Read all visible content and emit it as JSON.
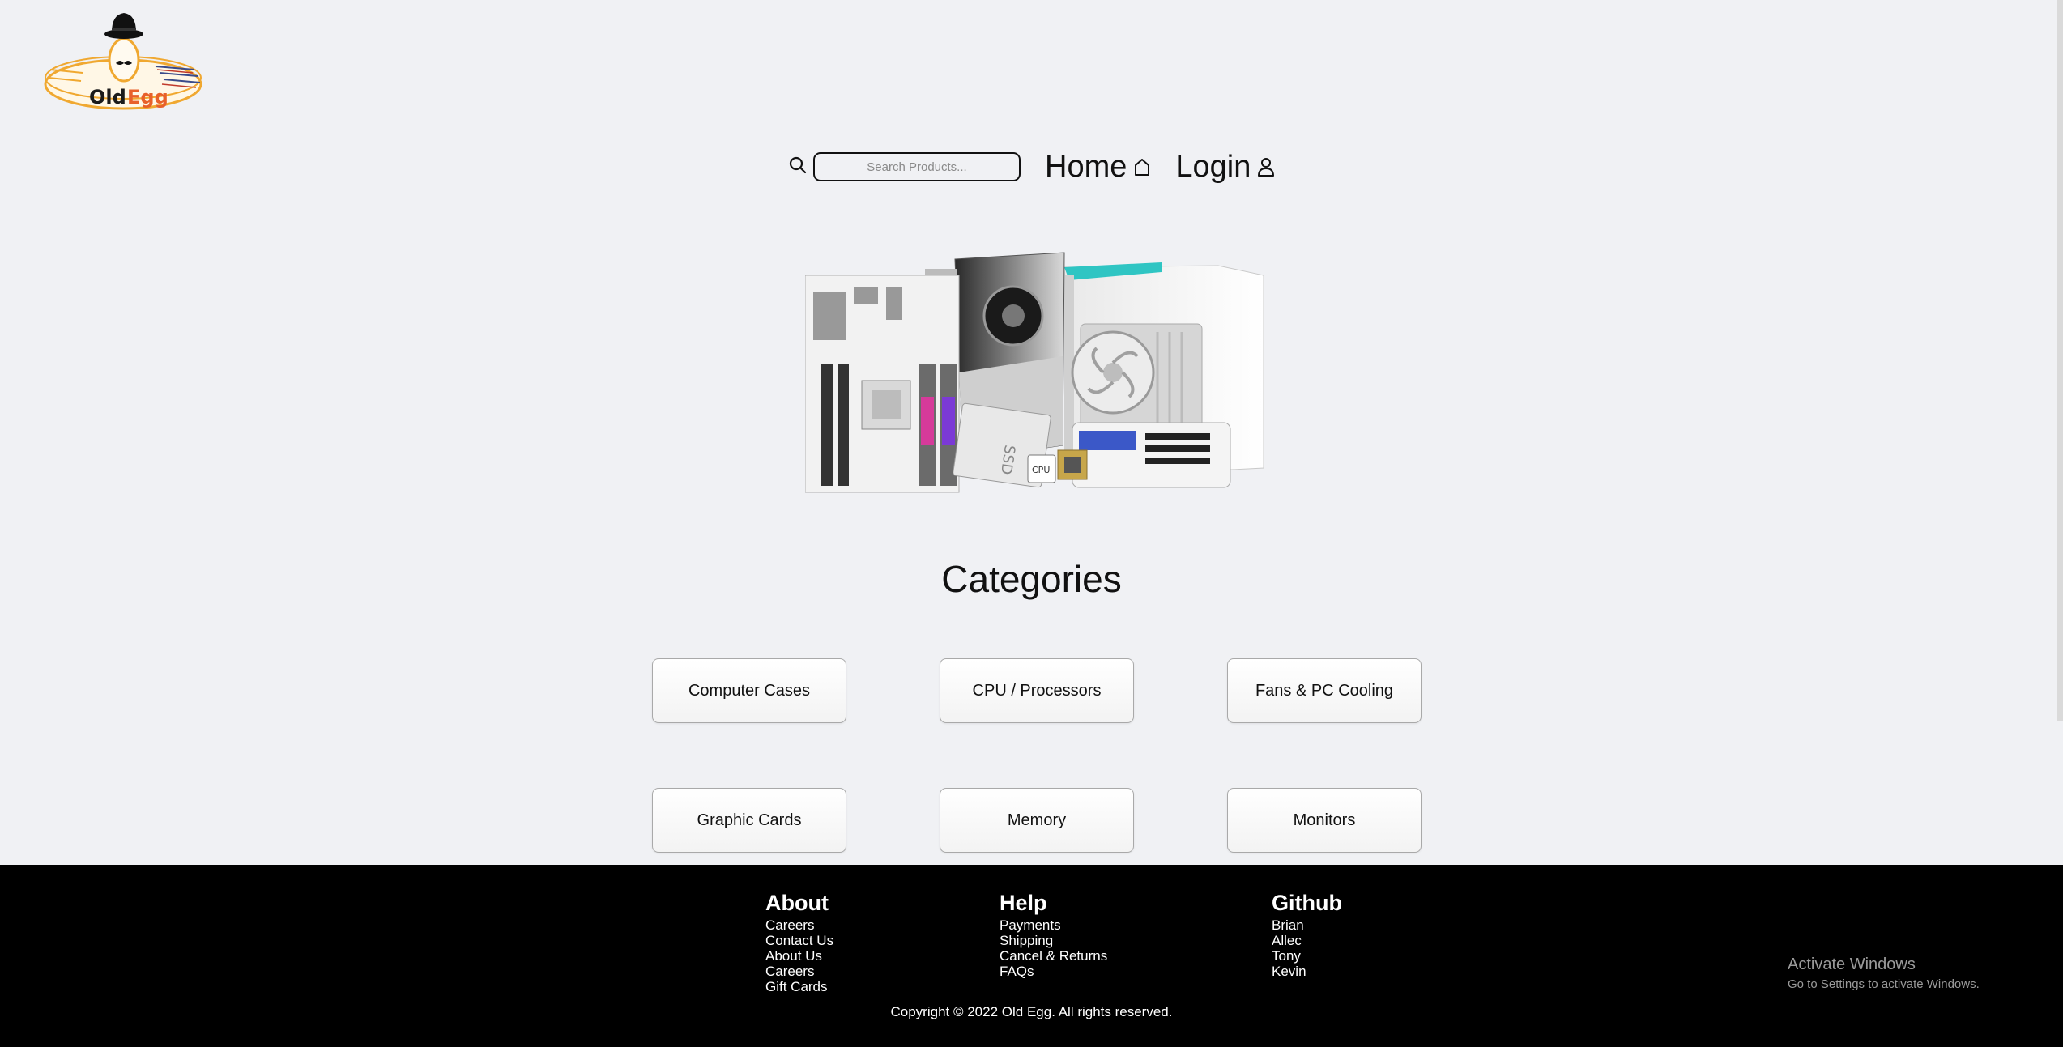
{
  "brand": {
    "logo_text_old": "Old",
    "logo_text_egg": "Egg"
  },
  "header": {
    "search": {
      "placeholder": "Search Products...",
      "value": ""
    },
    "nav": {
      "home_label": "Home",
      "login_label": "Login"
    }
  },
  "main": {
    "categories_title": "Categories",
    "categories": [
      {
        "label": "Computer Cases"
      },
      {
        "label": "CPU / Processors"
      },
      {
        "label": "Fans & PC Cooling"
      },
      {
        "label": "Graphic Cards"
      },
      {
        "label": "Memory"
      },
      {
        "label": "Monitors"
      }
    ]
  },
  "hero": {
    "cpu_label": "CPU",
    "ssd_label": "SSD"
  },
  "footer": {
    "about": {
      "heading": "About",
      "links": [
        "Careers",
        "Contact Us",
        "About Us",
        "Careers",
        "Gift Cards"
      ]
    },
    "help": {
      "heading": "Help",
      "links": [
        "Payments",
        "Shipping",
        "Cancel & Returns",
        "FAQs"
      ]
    },
    "github": {
      "heading": "Github",
      "links": [
        "Brian",
        "Allec",
        "Tony",
        "Kevin"
      ]
    },
    "copyright": "Copyright © 2022 Old Egg. All rights reserved."
  },
  "os_overlay": {
    "line1": "Activate Windows",
    "line2": "Go to Settings to activate Windows."
  },
  "colors": {
    "background": "#f0f1f4",
    "footer": "#000000",
    "logo_accent": "#f0a830",
    "logo_egg_text": "#e8602a"
  }
}
